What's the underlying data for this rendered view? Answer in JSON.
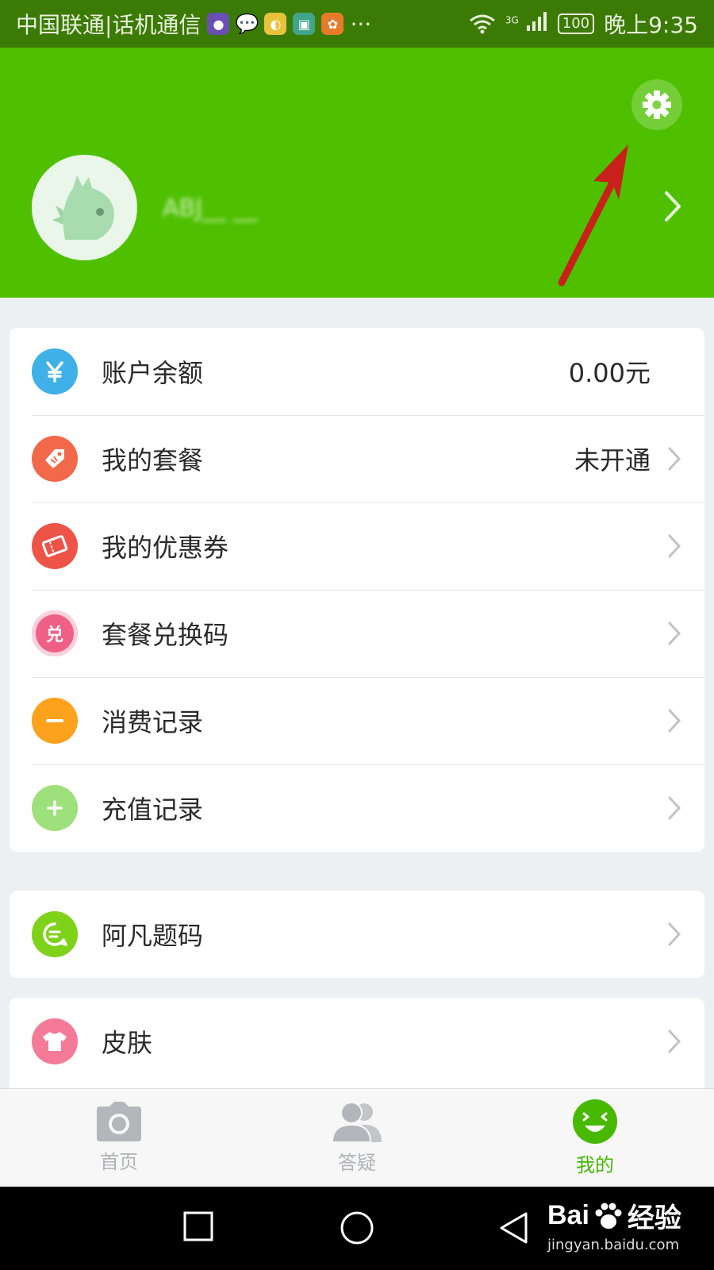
{
  "status_bar": {
    "carrier": "中国联通|话机通信",
    "more": "···",
    "network": "3G",
    "battery": "100",
    "time": "晚上9:35"
  },
  "header": {
    "username": "ABJ__ __"
  },
  "menu_group_1": [
    {
      "label": "账户余额",
      "value": "0.00元",
      "icon": "yuan-icon",
      "color": "#3fb0e8",
      "chevron": false
    },
    {
      "label": "我的套餐",
      "value": "未开通",
      "icon": "tag-icon",
      "color": "#f2694a",
      "chevron": true
    },
    {
      "label": "我的优惠券",
      "value": "",
      "icon": "ticket-icon",
      "color": "#ee5348",
      "chevron": true
    },
    {
      "label": "套餐兑换码",
      "value": "",
      "icon": "exchange-icon",
      "color": "#ef5f86",
      "chevron": true,
      "icon_text": "兑"
    },
    {
      "label": "消费记录",
      "value": "",
      "icon": "minus-icon",
      "color": "#fca21d",
      "chevron": true
    },
    {
      "label": "充值记录",
      "value": "",
      "icon": "plus-icon",
      "color": "#9ee07c",
      "chevron": true
    }
  ],
  "menu_group_2": [
    {
      "label": "阿凡题码",
      "icon": "chat-icon",
      "color": "#7fd21a"
    }
  ],
  "menu_group_3": [
    {
      "label": "皮肤",
      "icon": "shirt-icon",
      "color": "#f47a98"
    }
  ],
  "tabs": [
    {
      "label": "首页",
      "icon": "camera-icon",
      "active": false
    },
    {
      "label": "答疑",
      "icon": "users-icon",
      "active": false
    },
    {
      "label": "我的",
      "icon": "smile-icon",
      "active": true
    }
  ],
  "watermark": {
    "brand_a": "Bai",
    "brand_b": "经验",
    "url": "jingyan.baidu.com"
  },
  "colors": {
    "header": "#4ec000",
    "status_bar": "#3c7a06",
    "active_tab": "#46b900",
    "annotation_arrow": "#c8201b"
  }
}
